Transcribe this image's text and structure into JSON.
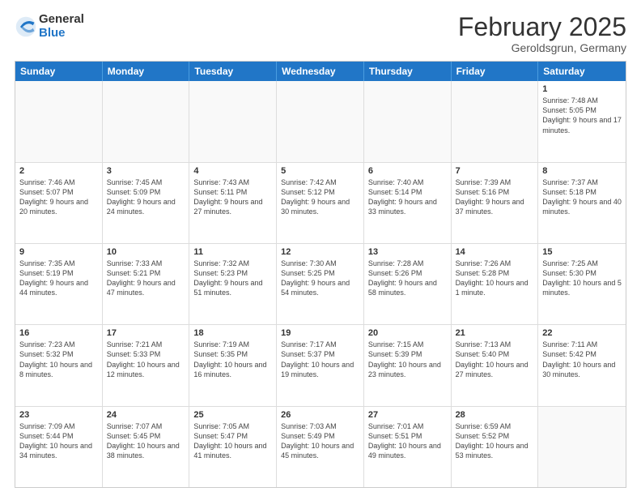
{
  "header": {
    "logo_general": "General",
    "logo_blue": "Blue",
    "month": "February 2025",
    "location": "Geroldsgrun, Germany"
  },
  "weekdays": [
    "Sunday",
    "Monday",
    "Tuesday",
    "Wednesday",
    "Thursday",
    "Friday",
    "Saturday"
  ],
  "weeks": [
    [
      {
        "day": "",
        "text": ""
      },
      {
        "day": "",
        "text": ""
      },
      {
        "day": "",
        "text": ""
      },
      {
        "day": "",
        "text": ""
      },
      {
        "day": "",
        "text": ""
      },
      {
        "day": "",
        "text": ""
      },
      {
        "day": "1",
        "text": "Sunrise: 7:48 AM\nSunset: 5:05 PM\nDaylight: 9 hours and 17 minutes."
      }
    ],
    [
      {
        "day": "2",
        "text": "Sunrise: 7:46 AM\nSunset: 5:07 PM\nDaylight: 9 hours and 20 minutes."
      },
      {
        "day": "3",
        "text": "Sunrise: 7:45 AM\nSunset: 5:09 PM\nDaylight: 9 hours and 24 minutes."
      },
      {
        "day": "4",
        "text": "Sunrise: 7:43 AM\nSunset: 5:11 PM\nDaylight: 9 hours and 27 minutes."
      },
      {
        "day": "5",
        "text": "Sunrise: 7:42 AM\nSunset: 5:12 PM\nDaylight: 9 hours and 30 minutes."
      },
      {
        "day": "6",
        "text": "Sunrise: 7:40 AM\nSunset: 5:14 PM\nDaylight: 9 hours and 33 minutes."
      },
      {
        "day": "7",
        "text": "Sunrise: 7:39 AM\nSunset: 5:16 PM\nDaylight: 9 hours and 37 minutes."
      },
      {
        "day": "8",
        "text": "Sunrise: 7:37 AM\nSunset: 5:18 PM\nDaylight: 9 hours and 40 minutes."
      }
    ],
    [
      {
        "day": "9",
        "text": "Sunrise: 7:35 AM\nSunset: 5:19 PM\nDaylight: 9 hours and 44 minutes."
      },
      {
        "day": "10",
        "text": "Sunrise: 7:33 AM\nSunset: 5:21 PM\nDaylight: 9 hours and 47 minutes."
      },
      {
        "day": "11",
        "text": "Sunrise: 7:32 AM\nSunset: 5:23 PM\nDaylight: 9 hours and 51 minutes."
      },
      {
        "day": "12",
        "text": "Sunrise: 7:30 AM\nSunset: 5:25 PM\nDaylight: 9 hours and 54 minutes."
      },
      {
        "day": "13",
        "text": "Sunrise: 7:28 AM\nSunset: 5:26 PM\nDaylight: 9 hours and 58 minutes."
      },
      {
        "day": "14",
        "text": "Sunrise: 7:26 AM\nSunset: 5:28 PM\nDaylight: 10 hours and 1 minute."
      },
      {
        "day": "15",
        "text": "Sunrise: 7:25 AM\nSunset: 5:30 PM\nDaylight: 10 hours and 5 minutes."
      }
    ],
    [
      {
        "day": "16",
        "text": "Sunrise: 7:23 AM\nSunset: 5:32 PM\nDaylight: 10 hours and 8 minutes."
      },
      {
        "day": "17",
        "text": "Sunrise: 7:21 AM\nSunset: 5:33 PM\nDaylight: 10 hours and 12 minutes."
      },
      {
        "day": "18",
        "text": "Sunrise: 7:19 AM\nSunset: 5:35 PM\nDaylight: 10 hours and 16 minutes."
      },
      {
        "day": "19",
        "text": "Sunrise: 7:17 AM\nSunset: 5:37 PM\nDaylight: 10 hours and 19 minutes."
      },
      {
        "day": "20",
        "text": "Sunrise: 7:15 AM\nSunset: 5:39 PM\nDaylight: 10 hours and 23 minutes."
      },
      {
        "day": "21",
        "text": "Sunrise: 7:13 AM\nSunset: 5:40 PM\nDaylight: 10 hours and 27 minutes."
      },
      {
        "day": "22",
        "text": "Sunrise: 7:11 AM\nSunset: 5:42 PM\nDaylight: 10 hours and 30 minutes."
      }
    ],
    [
      {
        "day": "23",
        "text": "Sunrise: 7:09 AM\nSunset: 5:44 PM\nDaylight: 10 hours and 34 minutes."
      },
      {
        "day": "24",
        "text": "Sunrise: 7:07 AM\nSunset: 5:45 PM\nDaylight: 10 hours and 38 minutes."
      },
      {
        "day": "25",
        "text": "Sunrise: 7:05 AM\nSunset: 5:47 PM\nDaylight: 10 hours and 41 minutes."
      },
      {
        "day": "26",
        "text": "Sunrise: 7:03 AM\nSunset: 5:49 PM\nDaylight: 10 hours and 45 minutes."
      },
      {
        "day": "27",
        "text": "Sunrise: 7:01 AM\nSunset: 5:51 PM\nDaylight: 10 hours and 49 minutes."
      },
      {
        "day": "28",
        "text": "Sunrise: 6:59 AM\nSunset: 5:52 PM\nDaylight: 10 hours and 53 minutes."
      },
      {
        "day": "",
        "text": ""
      }
    ]
  ]
}
